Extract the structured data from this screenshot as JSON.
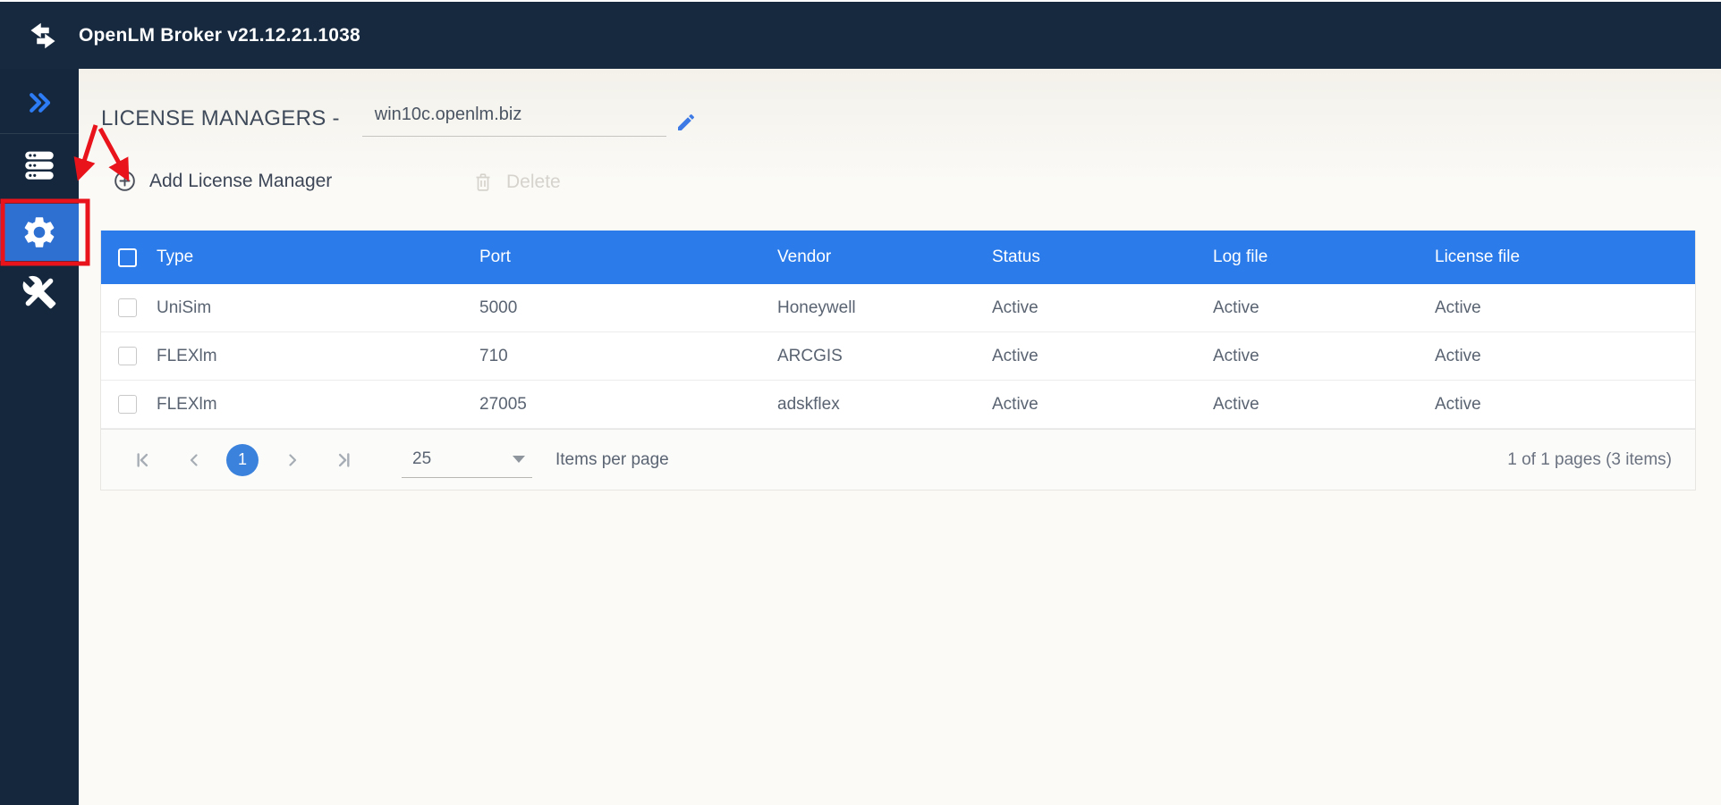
{
  "window": {
    "title": "OpenLM Broker v21.12.21.1038"
  },
  "sidebar": {
    "items": [
      {
        "id": "expand",
        "icon": "double-chevron-right-icon",
        "active": false
      },
      {
        "id": "license-servers",
        "icon": "servers-icon",
        "active": false
      },
      {
        "id": "settings",
        "icon": "gear-icon",
        "active": true
      },
      {
        "id": "tools",
        "icon": "tools-icon",
        "active": false
      }
    ]
  },
  "content": {
    "heading": "LICENSE MANAGERS -",
    "hostname": {
      "value": "win10c.openlm.biz",
      "edit_icon": "pencil-icon"
    },
    "toolbar": {
      "add_label": "Add License Manager",
      "add_icon": "circle-plus-icon",
      "delete_label": "Delete",
      "delete_icon": "trash-icon",
      "delete_enabled": false
    }
  },
  "table": {
    "columns": [
      "Type",
      "Port",
      "Vendor",
      "Status",
      "Log file",
      "License file"
    ],
    "rows": [
      {
        "type": "UniSim",
        "port": "5000",
        "vendor": "Honeywell",
        "status": "Active",
        "log_file": "Active",
        "license_file": "Active"
      },
      {
        "type": "FLEXlm",
        "port": "710",
        "vendor": "ARCGIS",
        "status": "Active",
        "log_file": "Active",
        "license_file": "Active"
      },
      {
        "type": "FLEXlm",
        "port": "27005",
        "vendor": "adskflex",
        "status": "Active",
        "log_file": "Active",
        "license_file": "Active"
      }
    ]
  },
  "pagination": {
    "current_page": "1",
    "items_per_page": "25",
    "items_per_page_label": "Items per page",
    "summary": "1 of 1 pages (3 items)"
  },
  "annotations": {
    "color": "#e8131b",
    "highlighted_item": "settings-nav-item",
    "arrow_targets": [
      "settings-nav-item",
      "add-license-manager-button"
    ]
  },
  "colors": {
    "topbar": "#17293f",
    "sidebar": "#14273c",
    "table_header_blue": "#2b7bea",
    "active_nav_blue": "#2e6fd2",
    "accent_blue": "#3d7ae5",
    "pager_circle_blue": "#3b82dd",
    "annotation_red": "#e8131b"
  }
}
